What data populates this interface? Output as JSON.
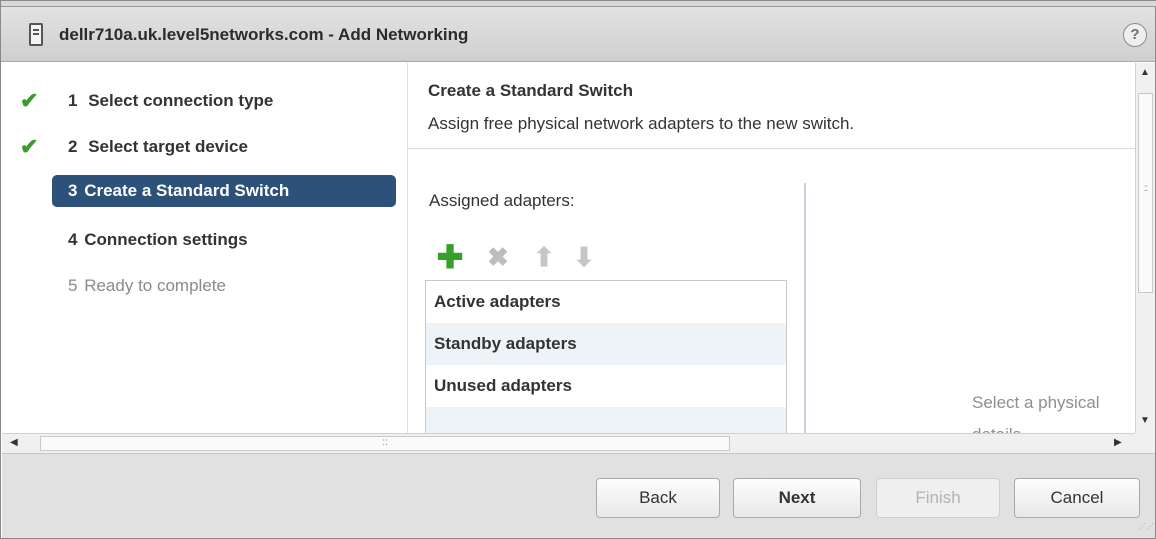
{
  "window": {
    "title": "dellr710a.uk.level5networks.com - Add Networking",
    "help": "?"
  },
  "nav": {
    "items": [
      {
        "number": "1",
        "label": "Select connection type",
        "status": "completed"
      },
      {
        "number": "2",
        "label": "Select target device",
        "status": "completed"
      },
      {
        "number": "3",
        "label": "Create a Standard Switch",
        "status": "active"
      },
      {
        "number": "4",
        "label": "Connection settings",
        "status": "pending"
      },
      {
        "number": "5",
        "label": "Ready to complete",
        "status": "disabled"
      }
    ],
    "check_glyph": "✔"
  },
  "content": {
    "title": "Create a Standard Switch",
    "subtitle": "Assign free physical network adapters to the new switch.",
    "assigned_label": "Assigned adapters:",
    "toolbar": {
      "add": "✚",
      "remove": "✖",
      "move_up": "⬆",
      "move_down": "⬇"
    },
    "adapter_groups": [
      "Active adapters",
      "Standby adapters",
      "Unused adapters"
    ],
    "detail_hint_line1": "Select a physical",
    "detail_hint_line2": "details"
  },
  "footer": {
    "back": "Back",
    "next": "Next",
    "finish": "Finish",
    "cancel": "Cancel"
  },
  "colors": {
    "active_nav": "#2d5178",
    "check": "#3b9b2c",
    "add_icon": "#37a02a"
  }
}
